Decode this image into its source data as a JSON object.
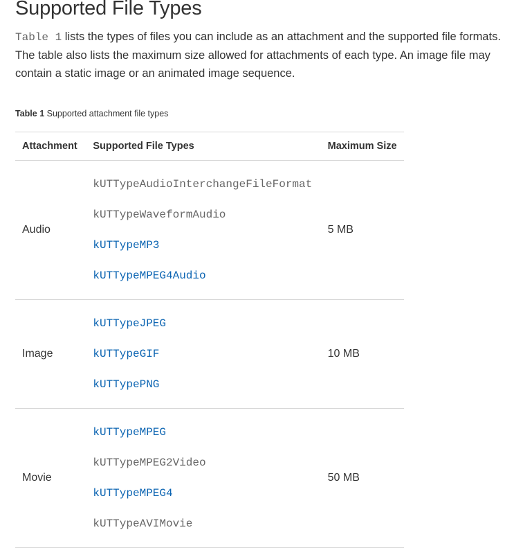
{
  "heading": "Supported File Types",
  "intro": {
    "code_ref": "Table 1",
    "text": " lists the types of files you can include as an attachment and the supported file formats. The table also lists the maximum size allowed for attachments of each type. An image file may contain a static image or an animated image sequence."
  },
  "caption": {
    "label": "Table 1",
    "text": " Supported attachment file types"
  },
  "table": {
    "headers": [
      "Attachment",
      "Supported File Types",
      "Maximum Size"
    ],
    "rows": [
      {
        "attachment": "Audio",
        "max_size": "5 MB",
        "types": [
          {
            "name": "kUTTypeAudioInterchangeFileFormat",
            "link": false
          },
          {
            "name": "kUTTypeWaveformAudio",
            "link": false
          },
          {
            "name": "kUTTypeMP3",
            "link": true
          },
          {
            "name": "kUTTypeMPEG4Audio",
            "link": true
          }
        ]
      },
      {
        "attachment": "Image",
        "max_size": "10 MB",
        "types": [
          {
            "name": "kUTTypeJPEG",
            "link": true
          },
          {
            "name": "kUTTypeGIF",
            "link": true
          },
          {
            "name": "kUTTypePNG",
            "link": true
          }
        ]
      },
      {
        "attachment": "Movie",
        "max_size": "50 MB",
        "types": [
          {
            "name": "kUTTypeMPEG",
            "link": true
          },
          {
            "name": "kUTTypeMPEG2Video",
            "link": false
          },
          {
            "name": "kUTTypeMPEG4",
            "link": true
          },
          {
            "name": "kUTTypeAVIMovie",
            "link": false
          }
        ]
      }
    ]
  },
  "colors": {
    "text": "#333333",
    "code": "#666666",
    "link": "#0b64b2",
    "divider": "#d6d6d6"
  }
}
